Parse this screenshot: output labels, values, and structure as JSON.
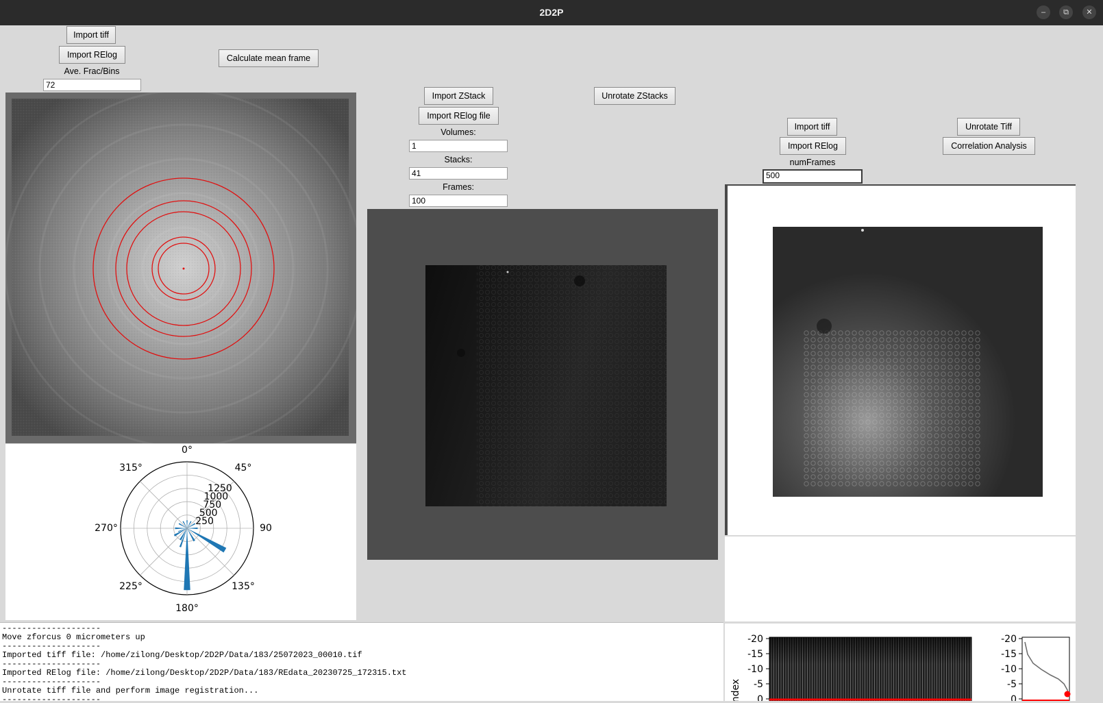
{
  "window": {
    "title": "2D2P",
    "minimize_icon": "minimize-icon",
    "maximize_icon": "maximize-icon",
    "close_icon": "close-icon"
  },
  "left_panel": {
    "import_tiff": "Import tiff",
    "import_relog": "Import RElog",
    "calc_mean": "Calculate mean frame",
    "ave_label": "Ave. Frac/Bins",
    "ave_value": "72"
  },
  "polar_plot": {
    "angle_labels": [
      "0°",
      "45°",
      "90",
      "135°",
      "180°",
      "225°",
      "270°",
      "315°"
    ],
    "radial_labels": [
      "250",
      "500",
      "750",
      "1000",
      "1250"
    ],
    "bar_color": "#1f77b4"
  },
  "middle_panel": {
    "import_zstack": "Import ZStack",
    "import_relog_file": "Import RElog file",
    "unrotate_zstacks": "Unrotate ZStacks",
    "volumes_label": "Volumes:",
    "volumes_value": "1",
    "stacks_label": "Stacks:",
    "stacks_value": "41",
    "frames_label": "Frames:",
    "frames_value": "100"
  },
  "right_panel": {
    "import_tiff": "Import tiff",
    "import_relog": "Import RElog",
    "unrotate_tiff": "Unrotate Tiff",
    "correlation": "Correlation Analysis",
    "numframes_label": "numFrames",
    "numframes_value": "500"
  },
  "bottom_plots": {
    "ylabel": "index",
    "left_ticks": [
      "-20",
      "-15",
      "-10",
      "-5",
      "0"
    ],
    "right_ticks": [
      "-20",
      "-15",
      "-10",
      "-5",
      "0"
    ],
    "line_color": "#ff0000",
    "marker_color": "#ff0000"
  },
  "console": {
    "lines": [
      "--------------------",
      "Move zforcus 0 micrometers up",
      "--------------------",
      "Imported tiff file: /home/zilong/Desktop/2D2P/Data/183/25072023_00010.tif",
      "--------------------",
      "Imported RElog file: /home/zilong/Desktop/2D2P/Data/183/REdata_20230725_172315.txt",
      "--------------------",
      "Unrotate tiff file and perform image registration...",
      "--------------------"
    ]
  }
}
